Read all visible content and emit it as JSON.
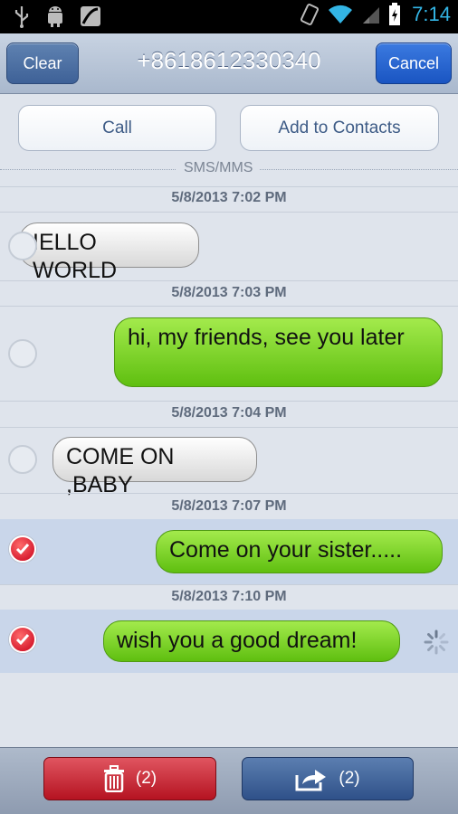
{
  "status_bar": {
    "icons": [
      "usb-icon",
      "android-debug-icon",
      "media-icon",
      "rotate-icon",
      "wifi-icon",
      "signal-icon",
      "battery-icon"
    ],
    "time": "7:14"
  },
  "header": {
    "clear_label": "Clear",
    "title": "+8618612330340",
    "cancel_label": "Cancel"
  },
  "actions": {
    "call_label": "Call",
    "add_contacts_label": "Add to Contacts"
  },
  "section_label": "SMS/MMS",
  "messages": [
    {
      "date": "5/8/2013 7:02 PM",
      "text": "IELLO WORLD",
      "direction": "incoming",
      "selected": false
    },
    {
      "date": "5/8/2013 7:03 PM",
      "text": "hi, my friends, see you later",
      "direction": "outgoing",
      "selected": false
    },
    {
      "date": "5/8/2013 7:04 PM",
      "text": "COME ON ,BABY",
      "direction": "incoming",
      "selected": false
    },
    {
      "date": "5/8/2013 7:07 PM",
      "text": "Come on your sister.....",
      "direction": "outgoing",
      "selected": true
    },
    {
      "date": "5/8/2013 7:10 PM",
      "text": "wish you a good dream!",
      "direction": "outgoing",
      "selected": true,
      "status": "sending"
    }
  ],
  "bottom_bar": {
    "delete_count": "(2)",
    "forward_count": "(2)"
  },
  "colors": {
    "outgoing_bubble": "#7fd52c",
    "incoming_bubble": "#eeeeee",
    "selected_row": "#c9d6ea",
    "delete_button": "#c82a36",
    "forward_button": "#3f62a0"
  }
}
